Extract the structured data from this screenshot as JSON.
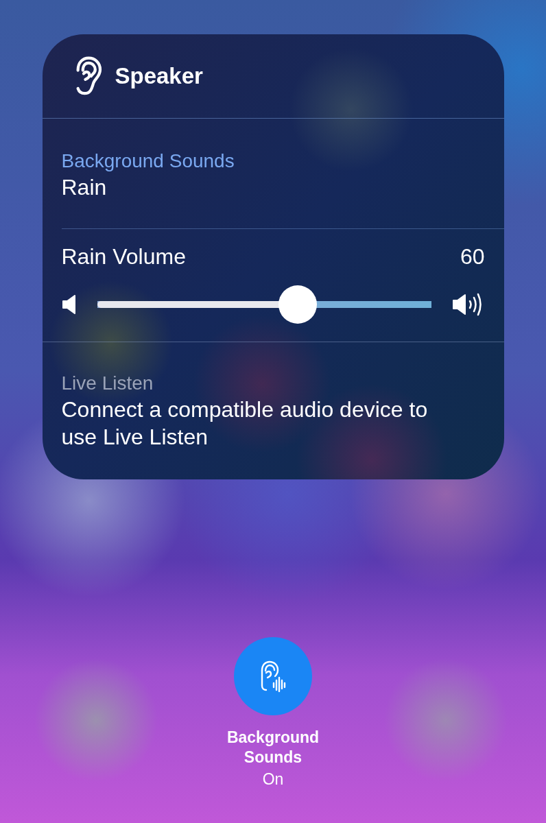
{
  "panel": {
    "title": "Speaker",
    "background_sounds": {
      "label": "Background Sounds",
      "value": "Rain"
    },
    "volume": {
      "label": "Rain Volume",
      "reading": "60",
      "level": 0.6
    },
    "live_listen": {
      "label": "Live Listen",
      "message": "Connect a compatible audio device to use Live Listen"
    }
  },
  "toggle": {
    "label": "Background Sounds",
    "status": "On",
    "on": true
  }
}
